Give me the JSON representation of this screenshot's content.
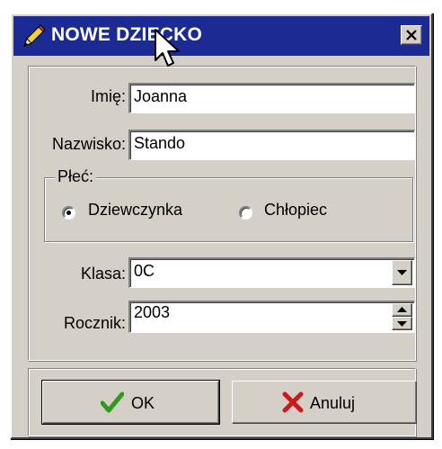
{
  "window": {
    "title": "NOWE DZIECKO",
    "title_icon": "pencil-icon",
    "close_icon": "close-icon"
  },
  "colors": {
    "titlebar": "#1c2b93",
    "face": "#d4d0c8",
    "ok_check": "#2f9a1e",
    "cancel_x": "#cc1a1a"
  },
  "form": {
    "first_name": {
      "label": "Imię:",
      "value": "Joanna"
    },
    "last_name": {
      "label": "Nazwisko:",
      "value": "Stando"
    },
    "gender": {
      "label": "Płeć:",
      "options": [
        {
          "label": "Dziewczynka",
          "checked": true
        },
        {
          "label": "Chłopiec",
          "checked": false
        }
      ]
    },
    "class": {
      "label": "Klasa:",
      "value": "0C"
    },
    "year": {
      "label": "Rocznik:",
      "value": "2003"
    }
  },
  "buttons": {
    "ok": {
      "label": "OK",
      "icon": "check-icon"
    },
    "cancel": {
      "label": "Anuluj",
      "icon": "x-icon"
    }
  }
}
